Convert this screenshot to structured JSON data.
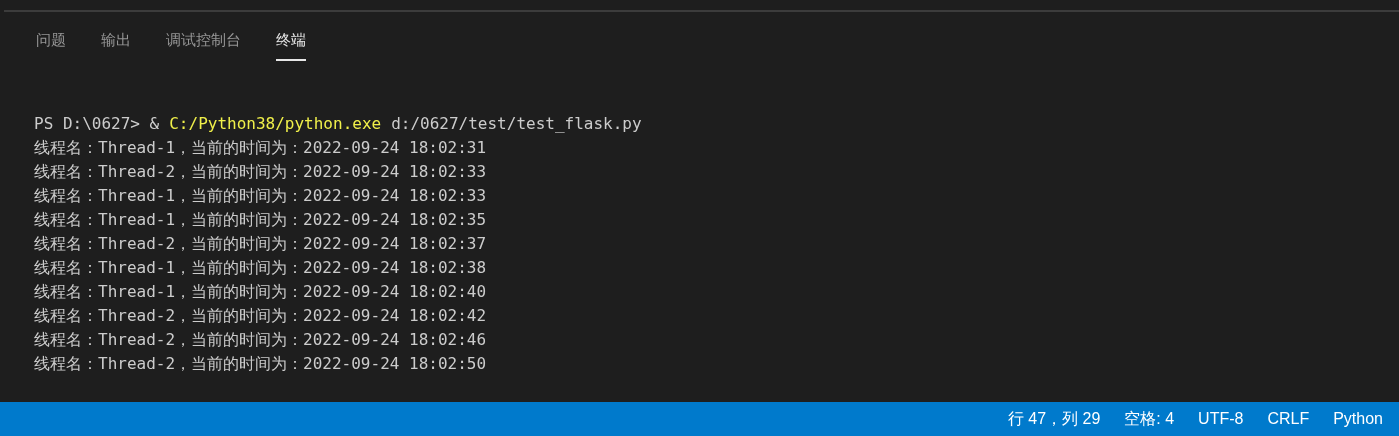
{
  "tabs": [
    {
      "label": "问题",
      "selected": false
    },
    {
      "label": "输出",
      "selected": false
    },
    {
      "label": "调试控制台",
      "selected": false
    },
    {
      "label": "终端",
      "selected": true
    }
  ],
  "terminal": {
    "command": {
      "prompt": "PS D:\\0627> &",
      "executable": "C:/Python38/python.exe",
      "argument": "d:/0627/test/test_flask.py"
    },
    "lines": [
      "线程名：Thread-1，当前的时间为：2022-09-24 18:02:31",
      "线程名：Thread-2，当前的时间为：2022-09-24 18:02:33",
      "线程名：Thread-1，当前的时间为：2022-09-24 18:02:33",
      "线程名：Thread-1，当前的时间为：2022-09-24 18:02:35",
      "线程名：Thread-2，当前的时间为：2022-09-24 18:02:37",
      "线程名：Thread-1，当前的时间为：2022-09-24 18:02:38",
      "线程名：Thread-1，当前的时间为：2022-09-24 18:02:40",
      "线程名：Thread-2，当前的时间为：2022-09-24 18:02:42",
      "线程名：Thread-2，当前的时间为：2022-09-24 18:02:46",
      "线程名：Thread-2，当前的时间为：2022-09-24 18:02:50"
    ]
  },
  "status_bar": {
    "items": [
      "行 47，列 29",
      "空格: 4",
      "UTF-8",
      "CRLF",
      "Python"
    ]
  }
}
